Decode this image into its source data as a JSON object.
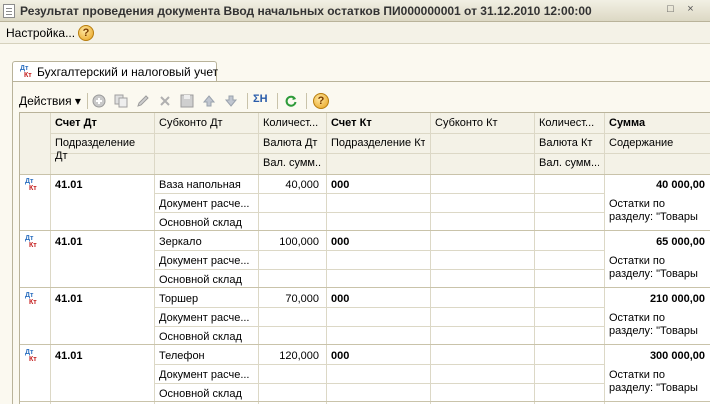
{
  "window": {
    "title": "Результат проведения документа Ввод начальных остатков ПИ000000001 от 31.12.2010 12:00:00",
    "buttons": {
      "restore": "□",
      "close": "×"
    }
  },
  "menubar": {
    "settings_label": "Настройка...",
    "help_symbol": "?"
  },
  "tab": {
    "label": "Бухгалтерский и налоговый учет",
    "icon_dt": "Дт",
    "icon_kt": "Кт"
  },
  "toolbar": {
    "actions_label": "Действия",
    "actions_arrow": "▾",
    "sum_icon": "ΣН",
    "help_symbol": "?"
  },
  "table": {
    "headers": {
      "row1": [
        "Счет Дт",
        "Субконто Дт",
        "Количест...",
        "Счет Кт",
        "Субконто Кт",
        "Количест...",
        "Сумма"
      ],
      "row2": [
        "Подразделение Дт",
        "",
        "Валюта Дт",
        "Подразделение Кт",
        "",
        "Валюта Кт",
        "Содержание"
      ],
      "row3": [
        "",
        "",
        "Вал. сумм...",
        "",
        "",
        "Вал. сумм...",
        ""
      ]
    },
    "rows": [
      {
        "account_dt": "41.01",
        "subconto": [
          "Ваза напольная",
          "Документ расче...",
          "Основной склад"
        ],
        "qty_dt": "40,000",
        "account_kt": "000",
        "sum": "40 000,00",
        "content": "Остатки по разделу: \"Товары"
      },
      {
        "account_dt": "41.01",
        "subconto": [
          "Зеркало",
          "Документ расче...",
          "Основной склад"
        ],
        "qty_dt": "100,000",
        "account_kt": "000",
        "sum": "65 000,00",
        "content": "Остатки по разделу: \"Товары"
      },
      {
        "account_dt": "41.01",
        "subconto": [
          "Торшер",
          "Документ расче...",
          "Основной склад"
        ],
        "qty_dt": "70,000",
        "account_kt": "000",
        "sum": "210 000,00",
        "content": "Остатки по разделу: \"Товары"
      },
      {
        "account_dt": "41.01",
        "subconto": [
          "Телефон",
          "Документ расче...",
          "Основной склад"
        ],
        "qty_dt": "120,000",
        "account_kt": "000",
        "sum": "300 000,00",
        "content": "Остатки по разделу: \"Товары"
      }
    ]
  },
  "colors": {
    "accent_header": "#f4f2e7",
    "border": "#b9b39a",
    "gridline": "#dcd8c6",
    "dt": "#2a6ebf",
    "kt": "#c41c1c"
  },
  "icons": [
    "document-icon",
    "add-icon",
    "copy-icon",
    "edit-icon",
    "delete-icon",
    "save-icon",
    "move-up-icon",
    "move-down-icon",
    "sum-icon",
    "refresh-icon",
    "help-icon"
  ]
}
